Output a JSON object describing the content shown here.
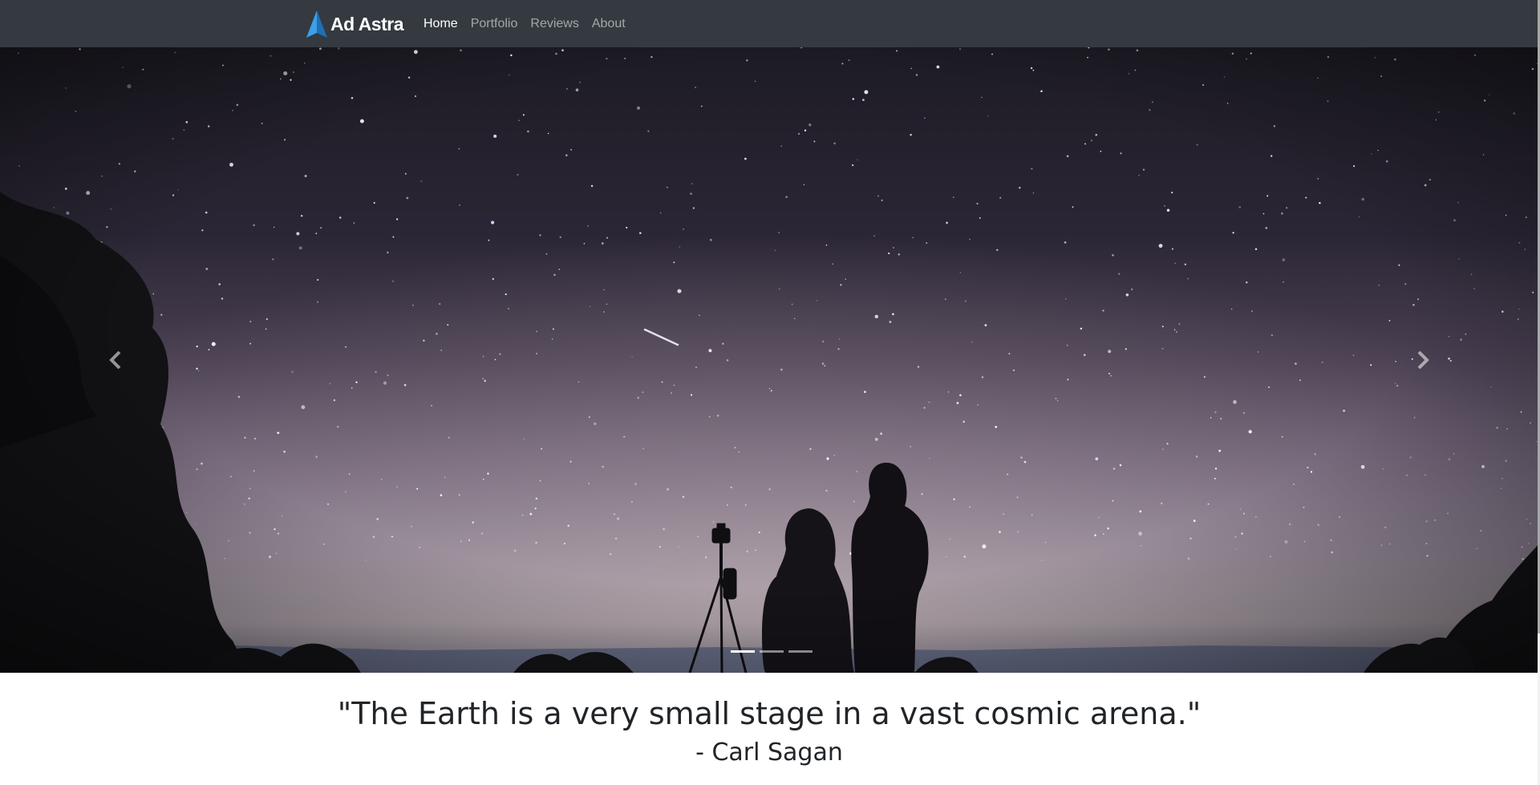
{
  "navbar": {
    "brand": "Ad Astra",
    "links": [
      {
        "label": "Home",
        "active": true
      },
      {
        "label": "Portfolio",
        "active": false
      },
      {
        "label": "Reviews",
        "active": false
      },
      {
        "label": "About",
        "active": false
      }
    ]
  },
  "carousel": {
    "slide_count": 3,
    "active_slide": 1,
    "prev_icon": "chevron-left-icon",
    "next_icon": "chevron-right-icon"
  },
  "quote": {
    "text": "\"The Earth is a very small stage in a vast cosmic arena.\"",
    "author": "- Carl Sagan"
  },
  "colors": {
    "navbar_bg": "#343a40",
    "brand_logo": "#2d8fd6",
    "page_bg": "#ffffff",
    "text": "#212529"
  }
}
